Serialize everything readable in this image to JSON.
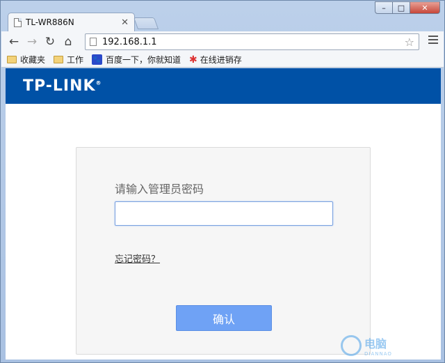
{
  "window": {
    "tab_title": "TL-WR886N",
    "controls": {
      "minimize": "–",
      "maximize": "□",
      "close": "✕"
    }
  },
  "toolbar": {
    "url": "192.168.1.1"
  },
  "bookmarks": [
    {
      "label": "收藏夹",
      "icon": "folder-icon"
    },
    {
      "label": "工作",
      "icon": "folder-icon"
    },
    {
      "label": "百度一下，你就知道",
      "icon": "baidu-paw-icon"
    },
    {
      "label": "在线进销存",
      "icon": "figure-icon"
    }
  ],
  "page": {
    "brand": "TP-LINK",
    "brand_mark": "®",
    "login": {
      "prompt": "请输入管理员密码",
      "password_value": "",
      "forgot_link": "忘记密码？",
      "confirm_label": "确认"
    },
    "watermark": {
      "text": "电脑",
      "sub": "DIANNAO"
    }
  },
  "colors": {
    "brand_bar": "#0051a6",
    "confirm_button": "#6fa2f5"
  }
}
